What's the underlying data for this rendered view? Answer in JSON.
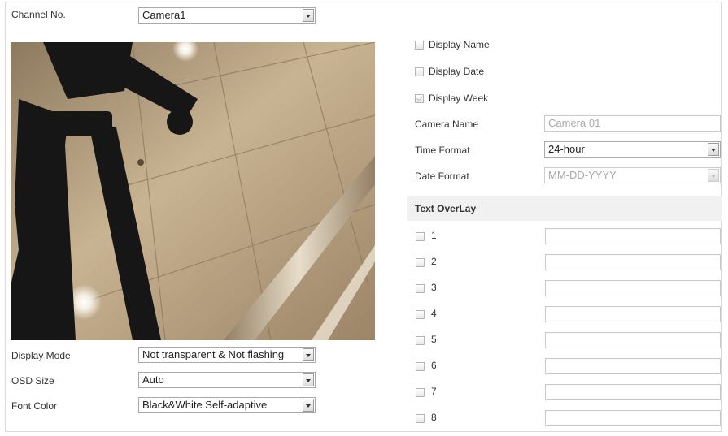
{
  "channel": {
    "label": "Channel No.",
    "value": "Camera1"
  },
  "options": {
    "display_name": {
      "label": "Display Name",
      "checked": false
    },
    "display_date": {
      "label": "Display Date",
      "checked": false
    },
    "display_week": {
      "label": "Display Week",
      "checked": true,
      "disabled": true
    }
  },
  "camera_name": {
    "label": "Camera Name",
    "value": "Camera 01"
  },
  "time_format": {
    "label": "Time Format",
    "value": "24-hour"
  },
  "date_format": {
    "label": "Date Format",
    "value": "MM-DD-YYYY"
  },
  "text_overlay": {
    "title": "Text OverLay",
    "items": [
      {
        "num": "1",
        "checked": false,
        "value": ""
      },
      {
        "num": "2",
        "checked": false,
        "value": ""
      },
      {
        "num": "3",
        "checked": false,
        "value": ""
      },
      {
        "num": "4",
        "checked": false,
        "value": ""
      },
      {
        "num": "5",
        "checked": false,
        "value": ""
      },
      {
        "num": "6",
        "checked": false,
        "value": ""
      },
      {
        "num": "7",
        "checked": false,
        "value": ""
      },
      {
        "num": "8",
        "checked": false,
        "value": ""
      }
    ]
  },
  "display_mode": {
    "label": "Display Mode",
    "value": "Not transparent & Not flashing"
  },
  "osd_size": {
    "label": "OSD Size",
    "value": "Auto"
  },
  "font_color": {
    "label": "Font Color",
    "value": "Black&White Self-adaptive"
  }
}
